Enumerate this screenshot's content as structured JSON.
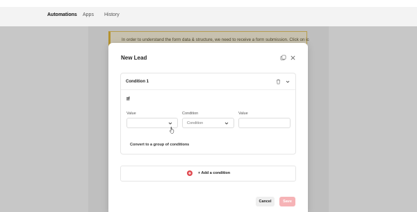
{
  "nav": {
    "items": [
      "Automations",
      "Apps",
      "History"
    ]
  },
  "banner": {
    "text": "In order to understand the form data & structure, we need to receive a form submission. Click on icon"
  },
  "modal": {
    "title": "New Lead",
    "condition": {
      "title": "Condition 1",
      "if_label": "If",
      "fields": [
        {
          "label": "Value",
          "placeholder": ""
        },
        {
          "label": "Condition",
          "placeholder": "Condition"
        },
        {
          "label": "Value",
          "placeholder": ""
        }
      ],
      "convert_label": "Convert to a group of conditions"
    },
    "add_condition_label": "+ Add a condition",
    "cancel_label": "Cancel",
    "save_label": "Save"
  },
  "colors": {
    "accent": "#e0484f",
    "save_disabled": "#f6b3b6",
    "banner_bg": "#fff7dc",
    "banner_border": "#e3b21f"
  }
}
